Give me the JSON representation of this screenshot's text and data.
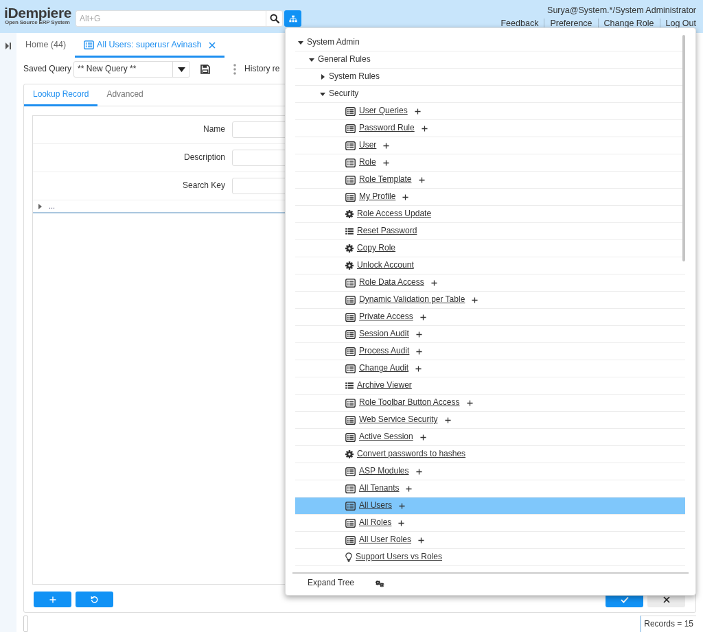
{
  "header": {
    "logo": {
      "title": "iDempiere",
      "tagline": "Open Source ERP System"
    },
    "search": {
      "placeholder": "Alt+G"
    },
    "user": "Surya@System.*/System Administrator",
    "links": [
      "Feedback",
      "Preference",
      "Change Role",
      "Log Out"
    ]
  },
  "window_tabs": [
    {
      "label": "Home (44)",
      "kind": "home",
      "selected": false,
      "closable": false
    },
    {
      "label": "All Users: superusr Avinash",
      "kind": "window",
      "selected": true,
      "closable": true
    }
  ],
  "query_bar": {
    "label": "Saved Query",
    "value": "** New Query **",
    "history_label": "History re"
  },
  "find_panel": {
    "tabs": [
      {
        "label": "Lookup Record",
        "selected": true
      },
      {
        "label": "Advanced",
        "selected": false
      }
    ],
    "fields": [
      {
        "label": "Name"
      },
      {
        "label": "Description"
      },
      {
        "label": "Search Key"
      }
    ],
    "more": {
      "label": "...",
      "expanded": false
    }
  },
  "status_bar": {
    "records": "Records = 15"
  },
  "menu_popup": {
    "tree": [
      {
        "label": "System Admin",
        "kind": "folder",
        "expanded": true,
        "selected": false,
        "children": [
          {
            "label": "General Rules",
            "kind": "folder",
            "expanded": true,
            "selected": false,
            "children": [
              {
                "label": "System Rules",
                "kind": "folder",
                "expanded": false,
                "selected": false
              },
              {
                "label": "Security",
                "kind": "folder",
                "expanded": true,
                "selected": false,
                "children": [
                  {
                    "label": "User Queries",
                    "kind": "window",
                    "selected": false
                  },
                  {
                    "label": "Password Rule",
                    "kind": "window",
                    "selected": false
                  },
                  {
                    "label": "User",
                    "kind": "window",
                    "selected": false
                  },
                  {
                    "label": "Role",
                    "kind": "window",
                    "selected": false
                  },
                  {
                    "label": "Role Template",
                    "kind": "window",
                    "selected": false
                  },
                  {
                    "label": "My Profile",
                    "kind": "window",
                    "selected": false
                  },
                  {
                    "label": "Role Access Update",
                    "kind": "process",
                    "selected": false
                  },
                  {
                    "label": "Reset Password",
                    "kind": "form",
                    "selected": false
                  },
                  {
                    "label": "Copy Role",
                    "kind": "process",
                    "selected": false
                  },
                  {
                    "label": "Unlock Account",
                    "kind": "process",
                    "selected": false
                  },
                  {
                    "label": "Role Data Access",
                    "kind": "window",
                    "selected": false
                  },
                  {
                    "label": "Dynamic Validation per Table",
                    "kind": "window",
                    "selected": false
                  },
                  {
                    "label": "Private Access",
                    "kind": "window",
                    "selected": false
                  },
                  {
                    "label": "Session Audit",
                    "kind": "window",
                    "selected": false
                  },
                  {
                    "label": "Process Audit",
                    "kind": "window",
                    "selected": false
                  },
                  {
                    "label": "Change Audit",
                    "kind": "window",
                    "selected": false
                  },
                  {
                    "label": "Archive Viewer",
                    "kind": "form",
                    "selected": false
                  },
                  {
                    "label": "Role Toolbar Button Access",
                    "kind": "window",
                    "selected": false
                  },
                  {
                    "label": "Web Service Security",
                    "kind": "window",
                    "selected": false
                  },
                  {
                    "label": "Active Session",
                    "kind": "window",
                    "selected": false
                  },
                  {
                    "label": "Convert passwords to hashes",
                    "kind": "process",
                    "selected": false
                  },
                  {
                    "label": "ASP Modules",
                    "kind": "window",
                    "selected": false
                  },
                  {
                    "label": "All Tenants",
                    "kind": "window",
                    "selected": false
                  },
                  {
                    "label": "All Users",
                    "kind": "window",
                    "selected": true
                  },
                  {
                    "label": "All Roles",
                    "kind": "window",
                    "selected": false
                  },
                  {
                    "label": "All User Roles",
                    "kind": "window",
                    "selected": false
                  },
                  {
                    "label": "Support Users vs Roles",
                    "kind": "workflow",
                    "selected": false
                  }
                ]
              }
            ]
          }
        ]
      }
    ],
    "footer": {
      "label": "Expand Tree"
    }
  }
}
